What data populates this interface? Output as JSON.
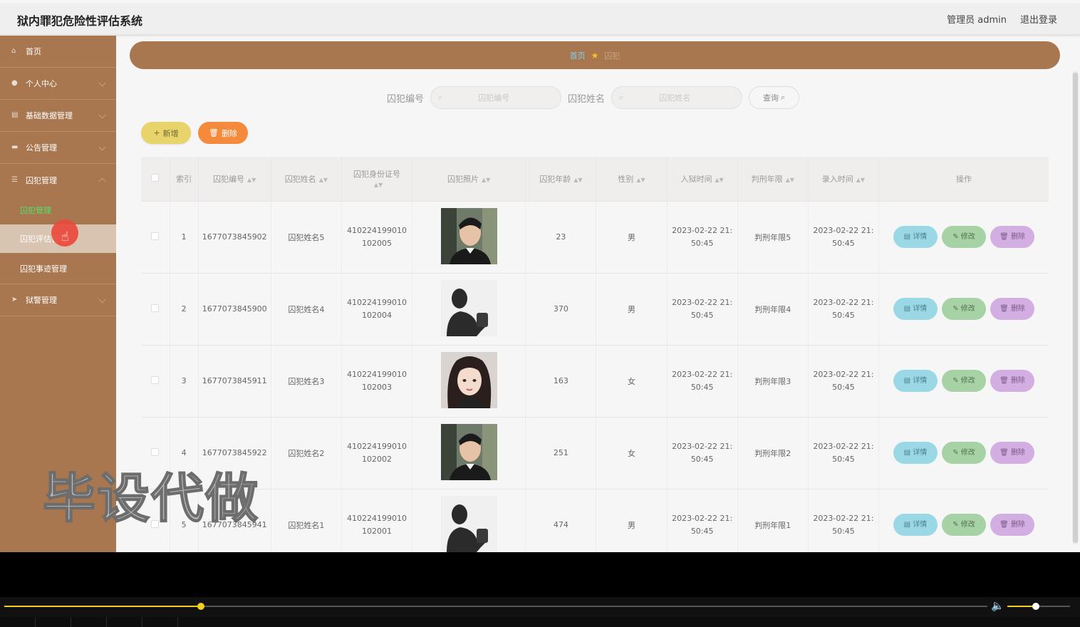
{
  "header": {
    "title": "狱内罪犯危险性评估系统",
    "user": "管理员 admin",
    "logout": "退出登录"
  },
  "sidebar": {
    "items": [
      {
        "label": "首页",
        "icon": "home-icon"
      },
      {
        "label": "个人中心",
        "icon": "user-icon"
      },
      {
        "label": "基础数据管理",
        "icon": "data-icon"
      },
      {
        "label": "公告管理",
        "icon": "notice-icon"
      },
      {
        "label": "囚犯管理",
        "icon": "list-icon"
      }
    ],
    "sub_items": [
      "囚犯管理",
      "囚犯评估管理",
      "囚犯事迹管理"
    ],
    "last_item": {
      "label": "狱警管理",
      "icon": "send-icon"
    }
  },
  "breadcrumb": {
    "home": "首页",
    "current": "囚犯"
  },
  "search": {
    "label1": "囚犯编号",
    "placeholder1": "囚犯编号",
    "label2": "囚犯姓名",
    "placeholder2": "囚犯姓名",
    "query_button": "查询"
  },
  "toolbar": {
    "add_label": "新增",
    "delete_label": "删除"
  },
  "table": {
    "headers": [
      "索引",
      "囚犯编号",
      "囚犯姓名",
      "囚犯身份证号",
      "囚犯照片",
      "囚犯年龄",
      "性别",
      "入狱时间",
      "判刑年限",
      "录入时间",
      "操作"
    ],
    "rows": [
      {
        "index": "1",
        "code": "1677073845902",
        "name": "囚犯姓名5",
        "id1": "410224199010",
        "id2": "102005",
        "age": "23",
        "gender": "男",
        "entry1": "2023-02-22 21:",
        "entry2": "50:45",
        "term": "判刑年限5",
        "rec1": "2023-02-22 21:",
        "rec2": "50:45",
        "photo": "man-photo"
      },
      {
        "index": "2",
        "code": "1677073845900",
        "name": "囚犯姓名4",
        "id1": "410224199010",
        "id2": "102004",
        "age": "370",
        "gender": "男",
        "entry1": "2023-02-22 21:",
        "entry2": "50:45",
        "term": "判刑年限4",
        "rec1": "2023-02-22 21:",
        "rec2": "50:45",
        "photo": "silhouette-photo"
      },
      {
        "index": "3",
        "code": "1677073845911",
        "name": "囚犯姓名3",
        "id1": "410224199010",
        "id2": "102003",
        "age": "163",
        "gender": "女",
        "entry1": "2023-02-22 21:",
        "entry2": "50:45",
        "term": "判刑年限3",
        "rec1": "2023-02-22 21:",
        "rec2": "50:45",
        "photo": "woman-photo"
      },
      {
        "index": "4",
        "code": "1677073845922",
        "name": "囚犯姓名2",
        "id1": "410224199010",
        "id2": "102002",
        "age": "251",
        "gender": "女",
        "entry1": "2023-02-22 21:",
        "entry2": "50:45",
        "term": "判刑年限2",
        "rec1": "2023-02-22 21:",
        "rec2": "50:45",
        "photo": "man-photo"
      },
      {
        "index": "5",
        "code": "1677073845941",
        "name": "囚犯姓名1",
        "id1": "410224199010",
        "id2": "102001",
        "age": "474",
        "gender": "男",
        "entry1": "2023-02-22 21:",
        "entry2": "50:45",
        "term": "判刑年限1",
        "rec1": "2023-02-22 21:",
        "rec2": "50:45",
        "photo": "silhouette-photo"
      }
    ],
    "actions": {
      "detail": "详情",
      "edit": "修改",
      "delete": "删除"
    }
  },
  "watermark": "毕设代做",
  "player": {
    "progress": 0.2,
    "volume": 0.45
  }
}
